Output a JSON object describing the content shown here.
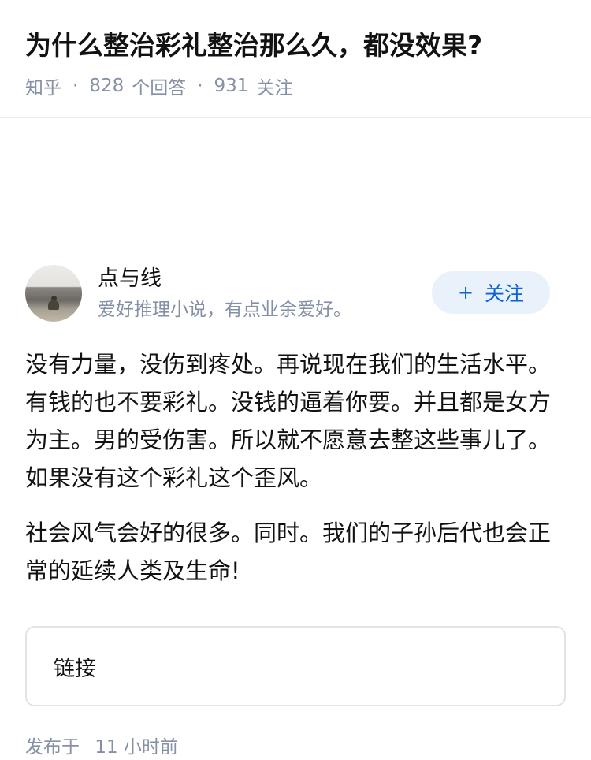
{
  "question": {
    "title": "为什么整治彩礼整治那么久，都没效果?",
    "source": "知乎",
    "dot1": "·",
    "answer_count": "828",
    "answer_count_label": "个回答",
    "dot2": "·",
    "follower_count": "931",
    "follower_label": "关注"
  },
  "author": {
    "name": "点与线",
    "bio": "爱好推理小说，有点业余爱好。",
    "follow_plus": "+",
    "follow_label": "关注"
  },
  "content": {
    "paragraphs": [
      "没有力量，没伤到疼处。再说现在我们的生活水平。有钱的也不要彩礼。没钱的逼着你要。并且都是女方为主。男的受伤害。所以就不愿意去整这些事儿了。如果没有这个彩礼这个歪风。",
      "社会风气会好的很多。同时。我们的子孙后代也会正常的延续人类及生命!"
    ]
  },
  "link_card": {
    "label": "链接"
  },
  "publish": {
    "prefix": "发布于",
    "time": "11 小时前"
  }
}
